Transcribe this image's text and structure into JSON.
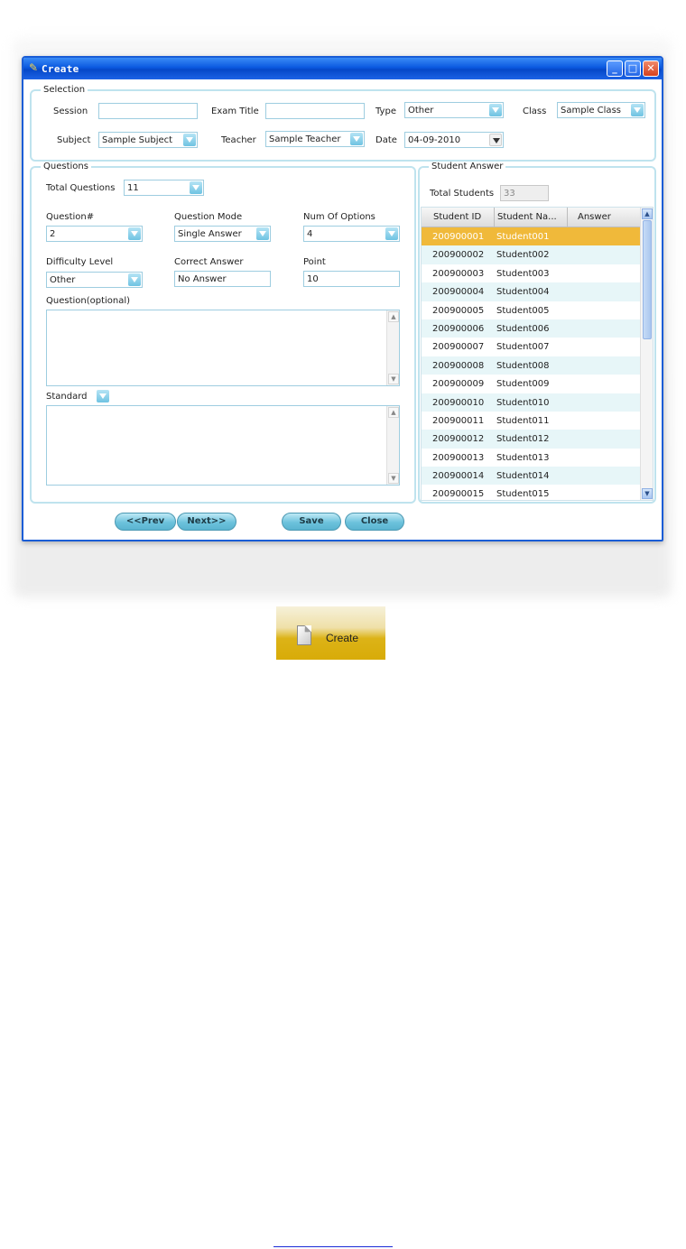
{
  "window": {
    "title": "Create",
    "minimize_label": "_",
    "maximize_label": "□",
    "close_label": "✕"
  },
  "selection": {
    "legend": "Selection",
    "session_label": "Session",
    "session_value": "",
    "exam_title_label": "Exam Title",
    "exam_title_value": "",
    "type_label": "Type",
    "type_value": "Other",
    "class_label": "Class",
    "class_value": "Sample Class",
    "subject_label": "Subject",
    "subject_value": "Sample Subject",
    "teacher_label": "Teacher",
    "teacher_value": "Sample Teacher",
    "date_label": "Date",
    "date_value": "04-09-2010"
  },
  "questions": {
    "legend": "Questions",
    "total_label": "Total Questions",
    "total_value": "11",
    "question_no_label": "Question#",
    "question_no_value": "2",
    "mode_label": "Question Mode",
    "mode_value": "Single Answer",
    "num_options_label": "Num Of Options",
    "num_options_value": "4",
    "difficulty_label": "Difficulty Level",
    "difficulty_value": "Other",
    "correct_label": "Correct Answer",
    "correct_value": "No Answer",
    "point_label": "Point",
    "point_value": "10",
    "question_text_label": "Question(optional)",
    "standard_label": "Standard"
  },
  "student_answer": {
    "legend": "Student Answer",
    "total_label": "Total Students",
    "total_value": "33",
    "columns": [
      "Student ID",
      "Student Na...",
      "Answer"
    ],
    "rows": [
      {
        "id": "200900001",
        "name": "Student001",
        "answer": ""
      },
      {
        "id": "200900002",
        "name": "Student002",
        "answer": ""
      },
      {
        "id": "200900003",
        "name": "Student003",
        "answer": ""
      },
      {
        "id": "200900004",
        "name": "Student004",
        "answer": ""
      },
      {
        "id": "200900005",
        "name": "Student005",
        "answer": ""
      },
      {
        "id": "200900006",
        "name": "Student006",
        "answer": ""
      },
      {
        "id": "200900007",
        "name": "Student007",
        "answer": ""
      },
      {
        "id": "200900008",
        "name": "Student008",
        "answer": ""
      },
      {
        "id": "200900009",
        "name": "Student009",
        "answer": ""
      },
      {
        "id": "200900010",
        "name": "Student010",
        "answer": ""
      },
      {
        "id": "200900011",
        "name": "Student011",
        "answer": ""
      },
      {
        "id": "200900012",
        "name": "Student012",
        "answer": ""
      },
      {
        "id": "200900013",
        "name": "Student013",
        "answer": ""
      },
      {
        "id": "200900014",
        "name": "Student014",
        "answer": ""
      },
      {
        "id": "200900015",
        "name": "Student015",
        "answer": ""
      }
    ],
    "selected_row": 0
  },
  "buttons": {
    "prev": "<<Prev",
    "next": "Next>>",
    "save": "Save",
    "close": "Close"
  },
  "create_button": {
    "label": "Create",
    "icon": "document-icon"
  },
  "colors": {
    "title_bar": "#0b59e0",
    "selected_row": "#f0b93a",
    "field_border": "#9ecde0"
  }
}
